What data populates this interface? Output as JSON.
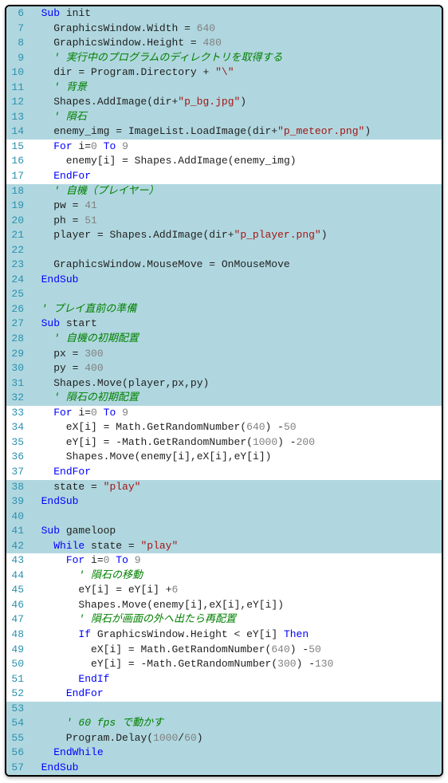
{
  "lines": [
    {
      "n": 6,
      "hl": true,
      "tokens": [
        [
          "id",
          "  "
        ],
        [
          "kw",
          "Sub"
        ],
        [
          "id",
          " init"
        ]
      ]
    },
    {
      "n": 7,
      "hl": true,
      "tokens": [
        [
          "id",
          "    GraphicsWindow"
        ],
        [
          "op",
          "."
        ],
        [
          "m",
          "Width"
        ],
        [
          "op",
          " = "
        ],
        [
          "num",
          "640"
        ]
      ]
    },
    {
      "n": 8,
      "hl": true,
      "tokens": [
        [
          "id",
          "    GraphicsWindow"
        ],
        [
          "op",
          "."
        ],
        [
          "m",
          "Height"
        ],
        [
          "op",
          " = "
        ],
        [
          "num",
          "480"
        ]
      ]
    },
    {
      "n": 9,
      "hl": true,
      "tokens": [
        [
          "id",
          "    "
        ],
        [
          "cmt",
          "' 実行中のプログラムのディレクトリを取得する"
        ]
      ]
    },
    {
      "n": 10,
      "hl": true,
      "tokens": [
        [
          "id",
          "    dir "
        ],
        [
          "op",
          "="
        ],
        [
          "id",
          " Program"
        ],
        [
          "op",
          "."
        ],
        [
          "m",
          "Directory"
        ],
        [
          "op",
          " + "
        ],
        [
          "str",
          "\"\\\""
        ]
      ]
    },
    {
      "n": 11,
      "hl": true,
      "tokens": [
        [
          "id",
          "    "
        ],
        [
          "cmt",
          "' 背景"
        ]
      ]
    },
    {
      "n": 12,
      "hl": true,
      "tokens": [
        [
          "id",
          "    Shapes"
        ],
        [
          "op",
          "."
        ],
        [
          "m",
          "AddImage"
        ],
        [
          "op",
          "("
        ],
        [
          "id",
          "dir"
        ],
        [
          "op",
          "+"
        ],
        [
          "str",
          "\"p_bg.jpg\""
        ],
        [
          "op",
          ")"
        ]
      ]
    },
    {
      "n": 13,
      "hl": true,
      "tokens": [
        [
          "id",
          "    "
        ],
        [
          "cmt",
          "' 隕石"
        ]
      ]
    },
    {
      "n": 14,
      "hl": true,
      "tokens": [
        [
          "id",
          "    enemy_img "
        ],
        [
          "op",
          "="
        ],
        [
          "id",
          " ImageList"
        ],
        [
          "op",
          "."
        ],
        [
          "m",
          "LoadImage"
        ],
        [
          "op",
          "("
        ],
        [
          "id",
          "dir"
        ],
        [
          "op",
          "+"
        ],
        [
          "str",
          "\"p_meteor.png\""
        ],
        [
          "op",
          ")"
        ]
      ]
    },
    {
      "n": 15,
      "hl": false,
      "tokens": [
        [
          "id",
          "    "
        ],
        [
          "kw",
          "For"
        ],
        [
          "id",
          " i"
        ],
        [
          "op",
          "="
        ],
        [
          "num",
          "0"
        ],
        [
          "id",
          " "
        ],
        [
          "kw",
          "To"
        ],
        [
          "id",
          " "
        ],
        [
          "num",
          "9"
        ]
      ]
    },
    {
      "n": 16,
      "hl": false,
      "tokens": [
        [
          "id",
          "      enemy"
        ],
        [
          "op",
          "["
        ],
        [
          "id",
          "i"
        ],
        [
          "op",
          "]"
        ],
        [
          "op",
          " = "
        ],
        [
          "id",
          "Shapes"
        ],
        [
          "op",
          "."
        ],
        [
          "m",
          "AddImage"
        ],
        [
          "op",
          "("
        ],
        [
          "id",
          "enemy_img"
        ],
        [
          "op",
          ")"
        ]
      ]
    },
    {
      "n": 17,
      "hl": false,
      "tokens": [
        [
          "id",
          "    "
        ],
        [
          "kw",
          "EndFor"
        ]
      ]
    },
    {
      "n": 18,
      "hl": true,
      "tokens": [
        [
          "id",
          "    "
        ],
        [
          "cmt",
          "' 自機（プレイヤー）"
        ]
      ]
    },
    {
      "n": 19,
      "hl": true,
      "tokens": [
        [
          "id",
          "    pw "
        ],
        [
          "op",
          "="
        ],
        [
          "id",
          " "
        ],
        [
          "num",
          "41"
        ]
      ]
    },
    {
      "n": 20,
      "hl": true,
      "tokens": [
        [
          "id",
          "    ph "
        ],
        [
          "op",
          "="
        ],
        [
          "id",
          " "
        ],
        [
          "num",
          "51"
        ]
      ]
    },
    {
      "n": 21,
      "hl": true,
      "tokens": [
        [
          "id",
          "    player "
        ],
        [
          "op",
          "="
        ],
        [
          "id",
          " Shapes"
        ],
        [
          "op",
          "."
        ],
        [
          "m",
          "AddImage"
        ],
        [
          "op",
          "("
        ],
        [
          "id",
          "dir"
        ],
        [
          "op",
          "+"
        ],
        [
          "str",
          "\"p_player.png\""
        ],
        [
          "op",
          ")"
        ]
      ]
    },
    {
      "n": 22,
      "hl": true,
      "tokens": [
        [
          "id",
          ""
        ]
      ]
    },
    {
      "n": 23,
      "hl": true,
      "tokens": [
        [
          "id",
          "    GraphicsWindow"
        ],
        [
          "op",
          "."
        ],
        [
          "m",
          "MouseMove"
        ],
        [
          "op",
          " = "
        ],
        [
          "id",
          "OnMouseMove"
        ]
      ]
    },
    {
      "n": 24,
      "hl": true,
      "tokens": [
        [
          "id",
          "  "
        ],
        [
          "kw",
          "EndSub"
        ]
      ]
    },
    {
      "n": 25,
      "hl": true,
      "tokens": [
        [
          "id",
          ""
        ]
      ]
    },
    {
      "n": 26,
      "hl": true,
      "tokens": [
        [
          "id",
          "  "
        ],
        [
          "cmt",
          "' プレイ直前の準備"
        ]
      ]
    },
    {
      "n": 27,
      "hl": true,
      "tokens": [
        [
          "id",
          "  "
        ],
        [
          "kw",
          "Sub"
        ],
        [
          "id",
          " start"
        ]
      ]
    },
    {
      "n": 28,
      "hl": true,
      "tokens": [
        [
          "id",
          "    "
        ],
        [
          "cmt",
          "' 自機の初期配置"
        ]
      ]
    },
    {
      "n": 29,
      "hl": true,
      "tokens": [
        [
          "id",
          "    px "
        ],
        [
          "op",
          "="
        ],
        [
          "id",
          " "
        ],
        [
          "num",
          "300"
        ]
      ]
    },
    {
      "n": 30,
      "hl": true,
      "tokens": [
        [
          "id",
          "    py "
        ],
        [
          "op",
          "="
        ],
        [
          "id",
          " "
        ],
        [
          "num",
          "400"
        ]
      ]
    },
    {
      "n": 31,
      "hl": true,
      "tokens": [
        [
          "id",
          "    Shapes"
        ],
        [
          "op",
          "."
        ],
        [
          "m",
          "Move"
        ],
        [
          "op",
          "("
        ],
        [
          "id",
          "player"
        ],
        [
          "op",
          ","
        ],
        [
          "id",
          "px"
        ],
        [
          "op",
          ","
        ],
        [
          "id",
          "py"
        ],
        [
          "op",
          ")"
        ]
      ]
    },
    {
      "n": 32,
      "hl": true,
      "tokens": [
        [
          "id",
          "    "
        ],
        [
          "cmt",
          "' 隕石の初期配置"
        ]
      ]
    },
    {
      "n": 33,
      "hl": false,
      "tokens": [
        [
          "id",
          "    "
        ],
        [
          "kw",
          "For"
        ],
        [
          "id",
          " i"
        ],
        [
          "op",
          "="
        ],
        [
          "num",
          "0"
        ],
        [
          "id",
          " "
        ],
        [
          "kw",
          "To"
        ],
        [
          "id",
          " "
        ],
        [
          "num",
          "9"
        ]
      ]
    },
    {
      "n": 34,
      "hl": false,
      "tokens": [
        [
          "id",
          "      eX"
        ],
        [
          "op",
          "["
        ],
        [
          "id",
          "i"
        ],
        [
          "op",
          "]"
        ],
        [
          "op",
          " = "
        ],
        [
          "id",
          "Math"
        ],
        [
          "op",
          "."
        ],
        [
          "m",
          "GetRandomNumber"
        ],
        [
          "op",
          "("
        ],
        [
          "num",
          "640"
        ],
        [
          "op",
          ")"
        ],
        [
          "id",
          " "
        ],
        [
          "op",
          "-"
        ],
        [
          "num",
          "50"
        ]
      ]
    },
    {
      "n": 35,
      "hl": false,
      "tokens": [
        [
          "id",
          "      eY"
        ],
        [
          "op",
          "["
        ],
        [
          "id",
          "i"
        ],
        [
          "op",
          "]"
        ],
        [
          "op",
          " = "
        ],
        [
          "op",
          "-"
        ],
        [
          "id",
          "Math"
        ],
        [
          "op",
          "."
        ],
        [
          "m",
          "GetRandomNumber"
        ],
        [
          "op",
          "("
        ],
        [
          "num",
          "1000"
        ],
        [
          "op",
          ")"
        ],
        [
          "id",
          " "
        ],
        [
          "op",
          "-"
        ],
        [
          "num",
          "200"
        ]
      ]
    },
    {
      "n": 36,
      "hl": false,
      "tokens": [
        [
          "id",
          "      Shapes"
        ],
        [
          "op",
          "."
        ],
        [
          "m",
          "Move"
        ],
        [
          "op",
          "("
        ],
        [
          "id",
          "enemy"
        ],
        [
          "op",
          "["
        ],
        [
          "id",
          "i"
        ],
        [
          "op",
          "]"
        ],
        [
          "op",
          ","
        ],
        [
          "id",
          "eX"
        ],
        [
          "op",
          "["
        ],
        [
          "id",
          "i"
        ],
        [
          "op",
          "]"
        ],
        [
          "op",
          ","
        ],
        [
          "id",
          "eY"
        ],
        [
          "op",
          "["
        ],
        [
          "id",
          "i"
        ],
        [
          "op",
          "]"
        ],
        [
          "op",
          ")"
        ]
      ]
    },
    {
      "n": 37,
      "hl": false,
      "tokens": [
        [
          "id",
          "    "
        ],
        [
          "kw",
          "EndFor"
        ]
      ]
    },
    {
      "n": 38,
      "hl": true,
      "tokens": [
        [
          "id",
          "    state "
        ],
        [
          "op",
          "="
        ],
        [
          "id",
          " "
        ],
        [
          "str",
          "\"play\""
        ]
      ]
    },
    {
      "n": 39,
      "hl": true,
      "tokens": [
        [
          "id",
          "  "
        ],
        [
          "kw",
          "EndSub"
        ]
      ]
    },
    {
      "n": 40,
      "hl": true,
      "tokens": [
        [
          "id",
          ""
        ]
      ]
    },
    {
      "n": 41,
      "hl": true,
      "tokens": [
        [
          "id",
          "  "
        ],
        [
          "kw",
          "Sub"
        ],
        [
          "id",
          " gameloop"
        ]
      ]
    },
    {
      "n": 42,
      "hl": true,
      "tokens": [
        [
          "id",
          "    "
        ],
        [
          "kw",
          "While"
        ],
        [
          "id",
          " state "
        ],
        [
          "op",
          "="
        ],
        [
          "id",
          " "
        ],
        [
          "str",
          "\"play\""
        ]
      ]
    },
    {
      "n": 43,
      "hl": false,
      "tokens": [
        [
          "id",
          "      "
        ],
        [
          "kw",
          "For"
        ],
        [
          "id",
          " i"
        ],
        [
          "op",
          "="
        ],
        [
          "num",
          "0"
        ],
        [
          "id",
          " "
        ],
        [
          "kw",
          "To"
        ],
        [
          "id",
          " "
        ],
        [
          "num",
          "9"
        ]
      ]
    },
    {
      "n": 44,
      "hl": false,
      "tokens": [
        [
          "id",
          "        "
        ],
        [
          "cmt",
          "' 隕石の移動"
        ]
      ]
    },
    {
      "n": 45,
      "hl": false,
      "tokens": [
        [
          "id",
          "        eY"
        ],
        [
          "op",
          "["
        ],
        [
          "id",
          "i"
        ],
        [
          "op",
          "]"
        ],
        [
          "op",
          " = "
        ],
        [
          "id",
          "eY"
        ],
        [
          "op",
          "["
        ],
        [
          "id",
          "i"
        ],
        [
          "op",
          "]"
        ],
        [
          "id",
          " "
        ],
        [
          "op",
          "+"
        ],
        [
          "num",
          "6"
        ]
      ]
    },
    {
      "n": 46,
      "hl": false,
      "tokens": [
        [
          "id",
          "        Shapes"
        ],
        [
          "op",
          "."
        ],
        [
          "m",
          "Move"
        ],
        [
          "op",
          "("
        ],
        [
          "id",
          "enemy"
        ],
        [
          "op",
          "["
        ],
        [
          "id",
          "i"
        ],
        [
          "op",
          "]"
        ],
        [
          "op",
          ","
        ],
        [
          "id",
          "eX"
        ],
        [
          "op",
          "["
        ],
        [
          "id",
          "i"
        ],
        [
          "op",
          "]"
        ],
        [
          "op",
          ","
        ],
        [
          "id",
          "eY"
        ],
        [
          "op",
          "["
        ],
        [
          "id",
          "i"
        ],
        [
          "op",
          "]"
        ],
        [
          "op",
          ")"
        ]
      ]
    },
    {
      "n": 47,
      "hl": false,
      "tokens": [
        [
          "id",
          "        "
        ],
        [
          "cmt",
          "' 隕石が画面の外へ出たら再配置"
        ]
      ]
    },
    {
      "n": 48,
      "hl": false,
      "tokens": [
        [
          "id",
          "        "
        ],
        [
          "kw",
          "If"
        ],
        [
          "id",
          " GraphicsWindow"
        ],
        [
          "op",
          "."
        ],
        [
          "m",
          "Height"
        ],
        [
          "op",
          " < "
        ],
        [
          "id",
          "eY"
        ],
        [
          "op",
          "["
        ],
        [
          "id",
          "i"
        ],
        [
          "op",
          "]"
        ],
        [
          "id",
          " "
        ],
        [
          "kw",
          "Then"
        ]
      ]
    },
    {
      "n": 49,
      "hl": false,
      "tokens": [
        [
          "id",
          "          eX"
        ],
        [
          "op",
          "["
        ],
        [
          "id",
          "i"
        ],
        [
          "op",
          "]"
        ],
        [
          "op",
          " = "
        ],
        [
          "id",
          "Math"
        ],
        [
          "op",
          "."
        ],
        [
          "m",
          "GetRandomNumber"
        ],
        [
          "op",
          "("
        ],
        [
          "num",
          "640"
        ],
        [
          "op",
          ")"
        ],
        [
          "id",
          " "
        ],
        [
          "op",
          "-"
        ],
        [
          "num",
          "50"
        ]
      ]
    },
    {
      "n": 50,
      "hl": false,
      "tokens": [
        [
          "id",
          "          eY"
        ],
        [
          "op",
          "["
        ],
        [
          "id",
          "i"
        ],
        [
          "op",
          "]"
        ],
        [
          "op",
          " = "
        ],
        [
          "op",
          "-"
        ],
        [
          "id",
          "Math"
        ],
        [
          "op",
          "."
        ],
        [
          "m",
          "GetRandomNumber"
        ],
        [
          "op",
          "("
        ],
        [
          "num",
          "300"
        ],
        [
          "op",
          ")"
        ],
        [
          "id",
          " "
        ],
        [
          "op",
          "-"
        ],
        [
          "num",
          "130"
        ]
      ]
    },
    {
      "n": 51,
      "hl": false,
      "tokens": [
        [
          "id",
          "        "
        ],
        [
          "kw",
          "EndIf"
        ]
      ]
    },
    {
      "n": 52,
      "hl": false,
      "tokens": [
        [
          "id",
          "      "
        ],
        [
          "kw",
          "EndFor"
        ]
      ]
    },
    {
      "n": 53,
      "hl": true,
      "tokens": [
        [
          "id",
          ""
        ]
      ]
    },
    {
      "n": 54,
      "hl": true,
      "tokens": [
        [
          "id",
          "      "
        ],
        [
          "cmt",
          "' 60 fps で動かす"
        ]
      ]
    },
    {
      "n": 55,
      "hl": true,
      "tokens": [
        [
          "id",
          "      Program"
        ],
        [
          "op",
          "."
        ],
        [
          "m",
          "Delay"
        ],
        [
          "op",
          "("
        ],
        [
          "num",
          "1000"
        ],
        [
          "op",
          "/"
        ],
        [
          "num",
          "60"
        ],
        [
          "op",
          ")"
        ]
      ]
    },
    {
      "n": 56,
      "hl": true,
      "tokens": [
        [
          "id",
          "    "
        ],
        [
          "kw",
          "EndWhile"
        ]
      ]
    },
    {
      "n": 57,
      "hl": true,
      "tokens": [
        [
          "id",
          "  "
        ],
        [
          "kw",
          "EndSub"
        ]
      ]
    }
  ]
}
